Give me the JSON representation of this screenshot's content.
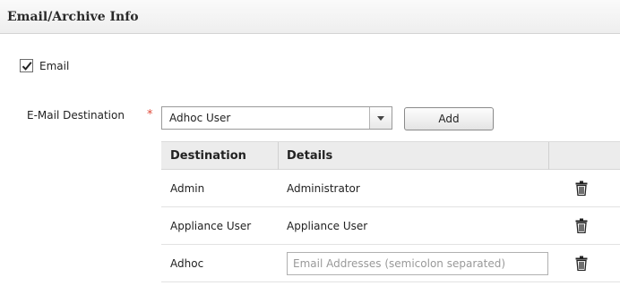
{
  "section": {
    "title": "Email/Archive Info"
  },
  "email_option": {
    "label": "Email",
    "checked": true
  },
  "destination": {
    "label": "E-Mail Destination",
    "required_mark": "*",
    "selected": "Adhoc User",
    "add_label": "Add"
  },
  "table": {
    "headers": [
      "Destination",
      "Details"
    ],
    "rows": [
      {
        "destination": "Admin",
        "details": "Administrator"
      },
      {
        "destination": "Appliance User",
        "details": "Appliance User"
      },
      {
        "destination": "Adhoc",
        "details_placeholder": "Email Addresses (semicolon separated)"
      }
    ]
  },
  "icons": {
    "checkbox": "checkmark-icon",
    "dropdown": "chevron-down-icon",
    "delete": "trash-icon"
  }
}
